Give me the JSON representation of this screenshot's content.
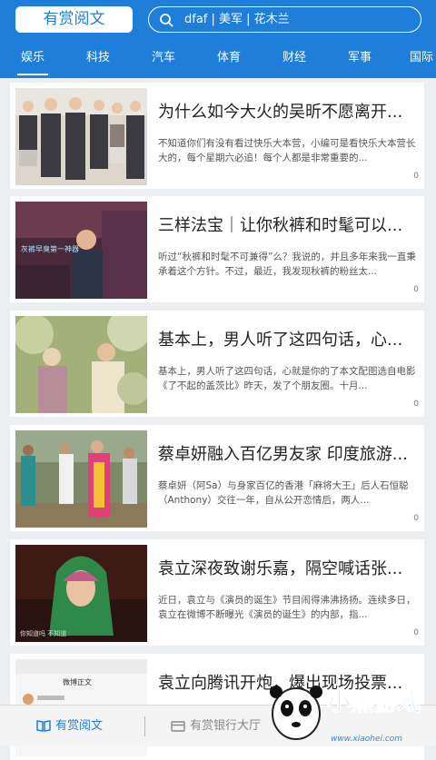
{
  "header": {
    "app_title": "有赏阅文",
    "search_text": "dfaf | 美军 | 花木兰"
  },
  "tabs": [
    {
      "label": "娱乐",
      "active": true
    },
    {
      "label": "科技"
    },
    {
      "label": "汽车"
    },
    {
      "label": "体育"
    },
    {
      "label": "财经"
    },
    {
      "label": "军事"
    },
    {
      "label": "国际"
    }
  ],
  "articles": [
    {
      "title": "为什么如今大火的吴昕不愿离开...",
      "desc": "不知道你们有没有看过快乐大本营，小编可是看快乐大本营长大的，每个星期六必追！每个人都是非常重要的...",
      "count": "0"
    },
    {
      "title": "三样法宝｜让你秋裤和时髦可以...",
      "desc": "听过“秋裤和时髦不可兼得”么？我说的，并且多年来我一直秉承着这个方针。不过，最近，我发现秋裤的粉丝太...",
      "count": "0",
      "thumb_caption": "灰裤早臭第一神器"
    },
    {
      "title": "基本上，男人听了这四句话，心...",
      "desc": "基本上，男人听了这四句话，心就是你的了本文配图选自电影《了不起的盖茨比》昨天，发了个朋友圈。十月...",
      "count": "0"
    },
    {
      "title": "蔡卓妍融入百亿男友家 印度旅游...",
      "desc": "蔡卓妍（阿Sa）与身家百亿的香港「麻将大王」后人石恒聪（Anthony）交往一年，自从公开恋情后，两人...",
      "count": "0"
    },
    {
      "title": "袁立深夜致谢乐嘉，隔空喊话张...",
      "desc": "近日，袁立与《演员的诞生》节目闹得沸沸扬扬。连续多日，袁立在微博不断曝光《演员的诞生》的内部，指...",
      "count": "0",
      "thumb_caption": "你知道吗  不知道"
    },
    {
      "title": "袁立向腾讯开炮，爆出现场投票...",
      "desc": "",
      "count": "",
      "thumb_caption": "微博正文"
    }
  ],
  "bottom_nav": {
    "item1": "有赏阅文",
    "item2": "有赏银行大厅"
  },
  "watermark": {
    "brand": "小黑游戏",
    "url": "www.xiaohei.com"
  },
  "colors": {
    "primary": "#1f7ed9",
    "background": "#eceff2"
  }
}
